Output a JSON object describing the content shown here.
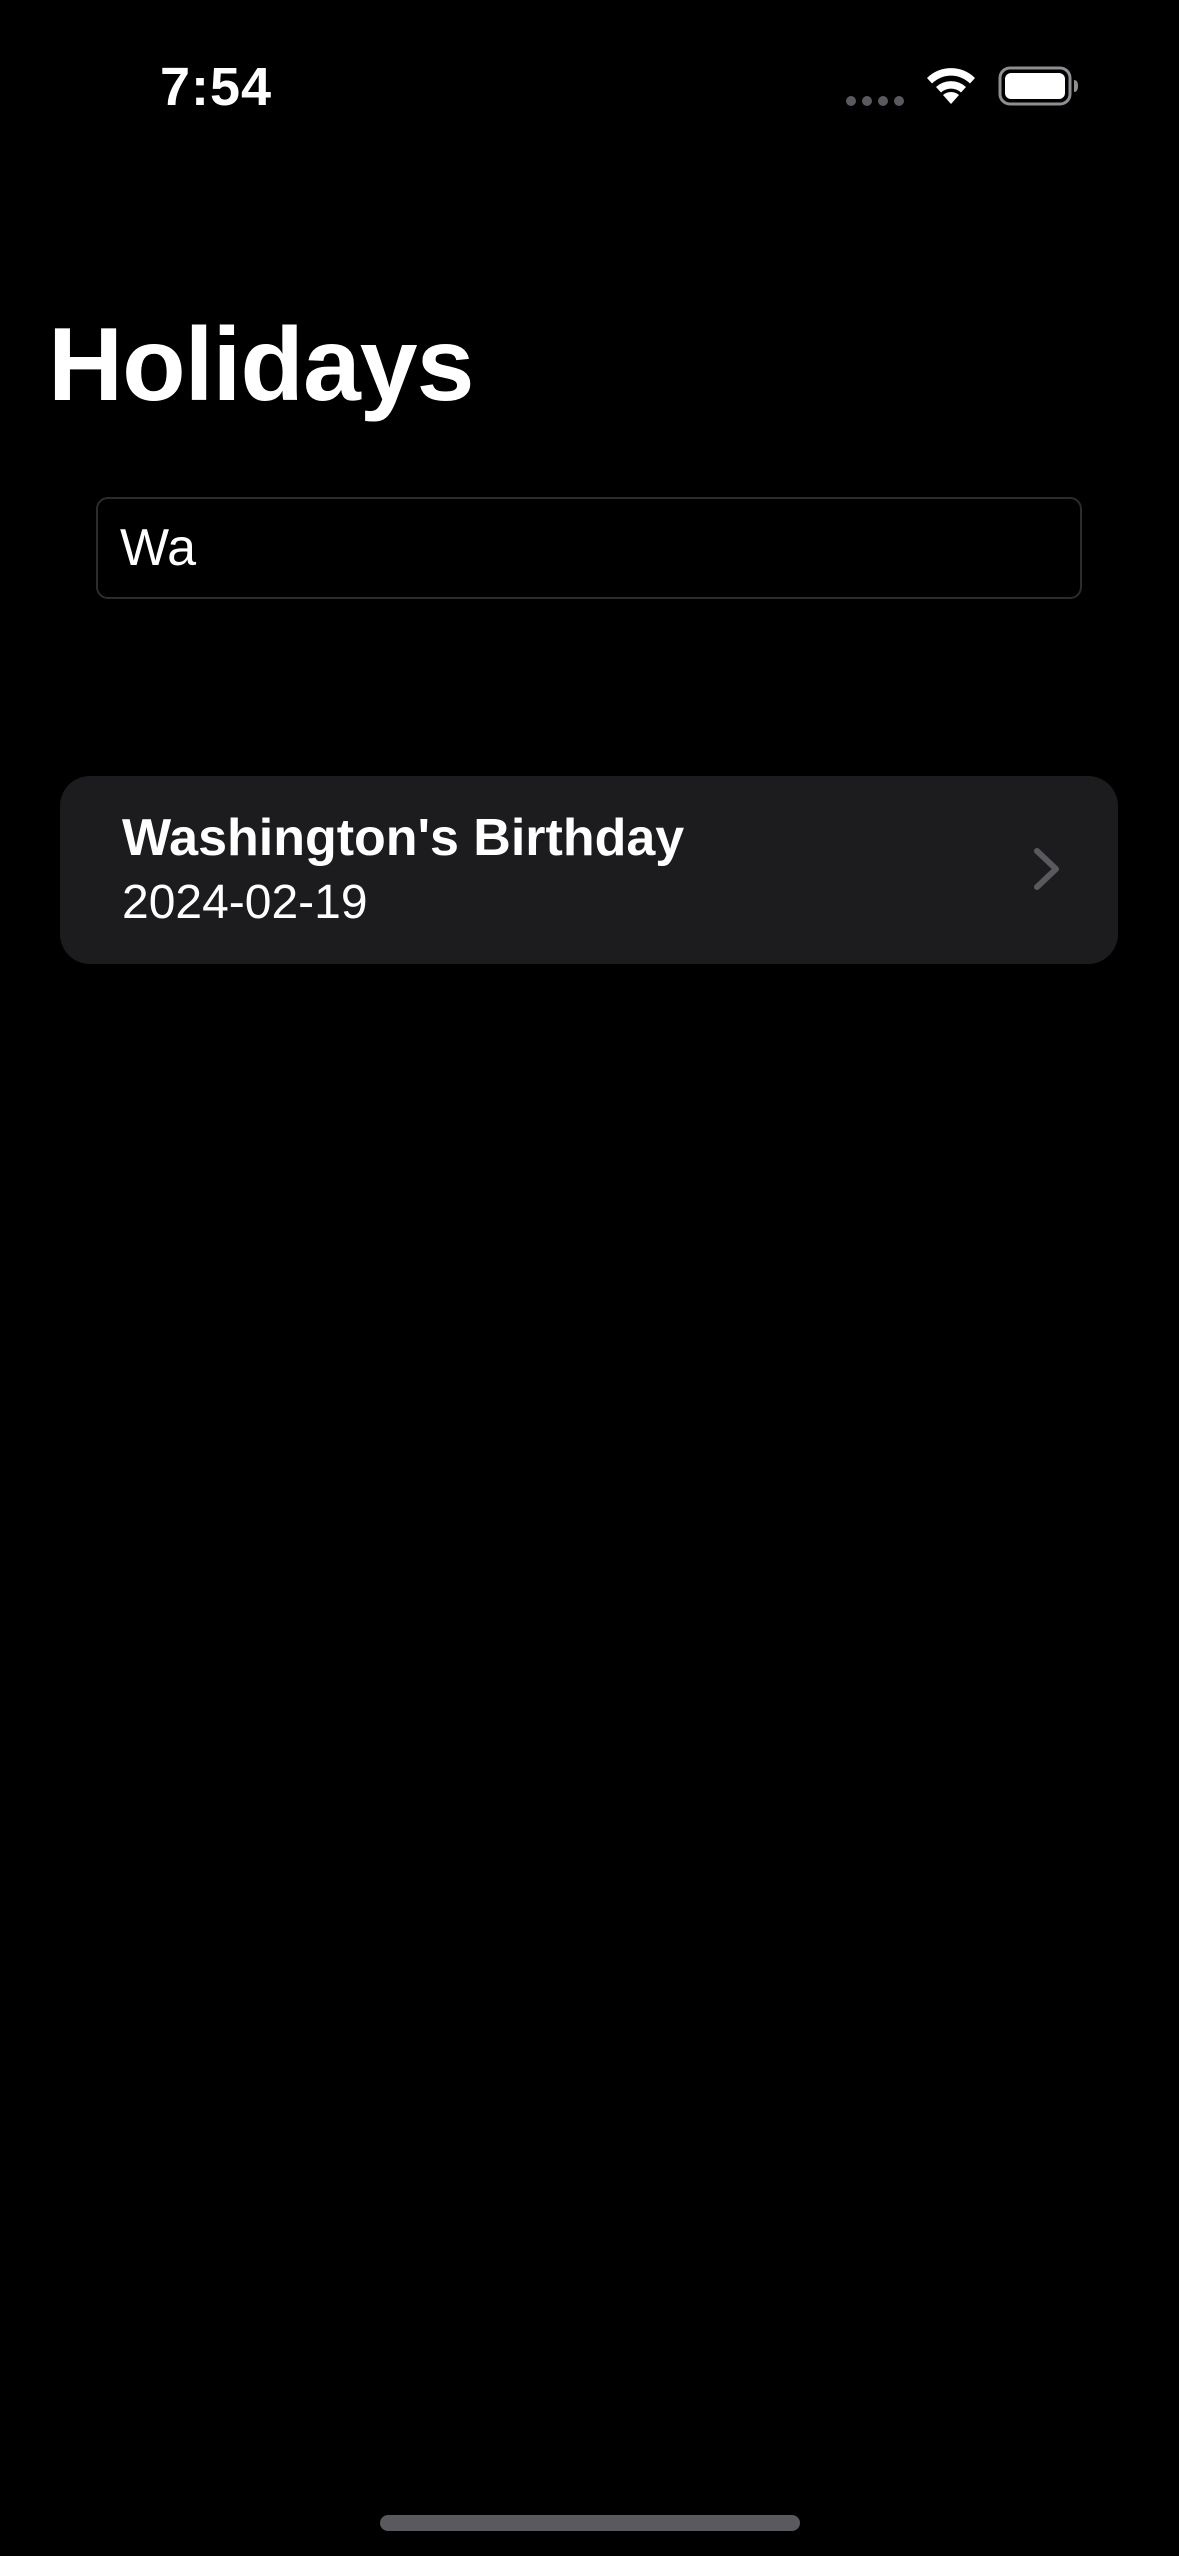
{
  "status_bar": {
    "time": "7:54",
    "signal_icon": "cellular-signal-dots-icon",
    "wifi_icon": "wifi-icon",
    "battery_icon": "battery-full-icon"
  },
  "header": {
    "title": "Holidays"
  },
  "search": {
    "value": "Wa",
    "placeholder": ""
  },
  "holidays": [
    {
      "name": "Washington's Birthday",
      "date": "2024-02-19",
      "accessory_icon": "chevron-right-icon"
    }
  ],
  "colors": {
    "background": "#000000",
    "card": "#1c1c1e",
    "field_border": "#2c2c2e",
    "chevron": "#5a5a5e",
    "text": "#ffffff"
  }
}
